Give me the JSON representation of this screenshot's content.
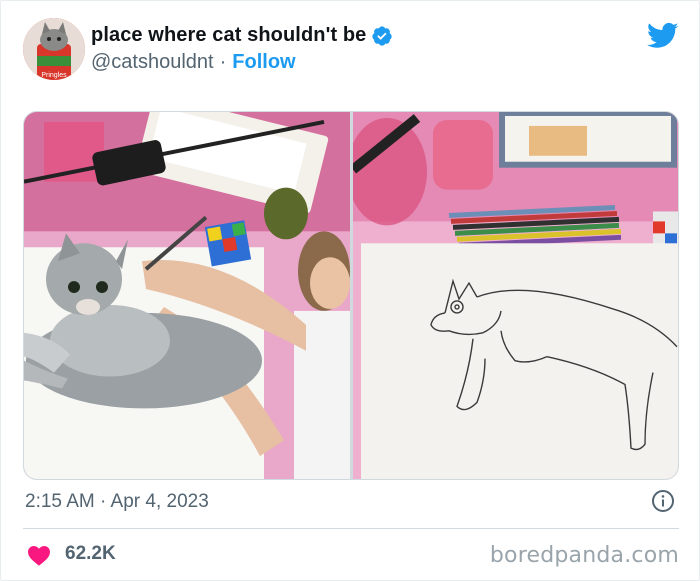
{
  "tweet": {
    "display_name": "place where cat shouldn't be",
    "handle": "@catshouldnt",
    "separator": "·",
    "follow_label": "Follow",
    "avatar_text": "Pringles",
    "timestamp": "2:15 AM · Apr 4, 2023",
    "likes": "62.2K"
  },
  "icons": {
    "verified": "verified-badge-icon",
    "bird": "twitter-bird-icon",
    "info": "info-icon",
    "heart": "heart-icon"
  },
  "colors": {
    "accent": "#1d9bf0",
    "heart": "#f91880",
    "secondary_text": "#536471"
  },
  "watermark": "boredpanda.com"
}
